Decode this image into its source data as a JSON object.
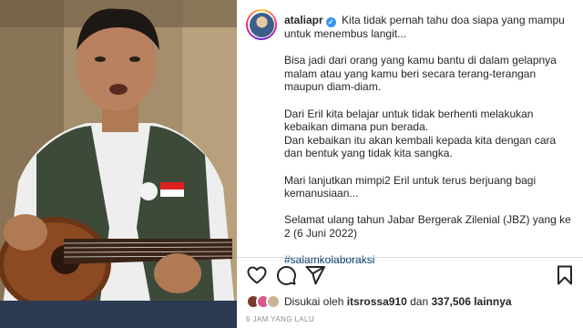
{
  "post": {
    "username": "ataliapr",
    "verified_glyph": "✓",
    "caption_lines": [
      "Kita tidak pernah tahu doa siapa yang mampu untuk menembus langit...",
      "Bisa jadi dari orang yang kamu bantu di dalam gelapnya malam atau yang kamu beri secara terang-terangan maupun diam-diam.",
      "Dari Eril kita belajar untuk tidak berhenti melakukan kebaikan dimana pun berada.",
      "Dan kebaikan itu akan kembali kepada kita dengan cara dan bentuk yang tidak kita sangka.",
      "Mari lanjutkan mimpi2 Eril untuk terus berjuang bagi kemanusiaan...",
      "Selamat ulang tahun Jabar Bergerak Zilenial (JBZ) yang ke 2 (6 Juni 2022)"
    ],
    "hashtag": "#salamkolaboraksi",
    "likes": {
      "prefix": "Disukai oleh",
      "user": "itsrossa910",
      "connector": "dan",
      "count": "337,506",
      "suffix": "lainnya"
    },
    "timestamp": "6 JAM YANG LALU"
  },
  "icons": {
    "like": "heart-icon",
    "comment": "comment-icon",
    "share": "send-icon",
    "save": "bookmark-icon",
    "verified": "verified-badge-icon"
  },
  "colors": {
    "verified": "#3897f0",
    "hashtag": "#00376b",
    "text": "#262626",
    "muted": "#8e8e8e"
  }
}
